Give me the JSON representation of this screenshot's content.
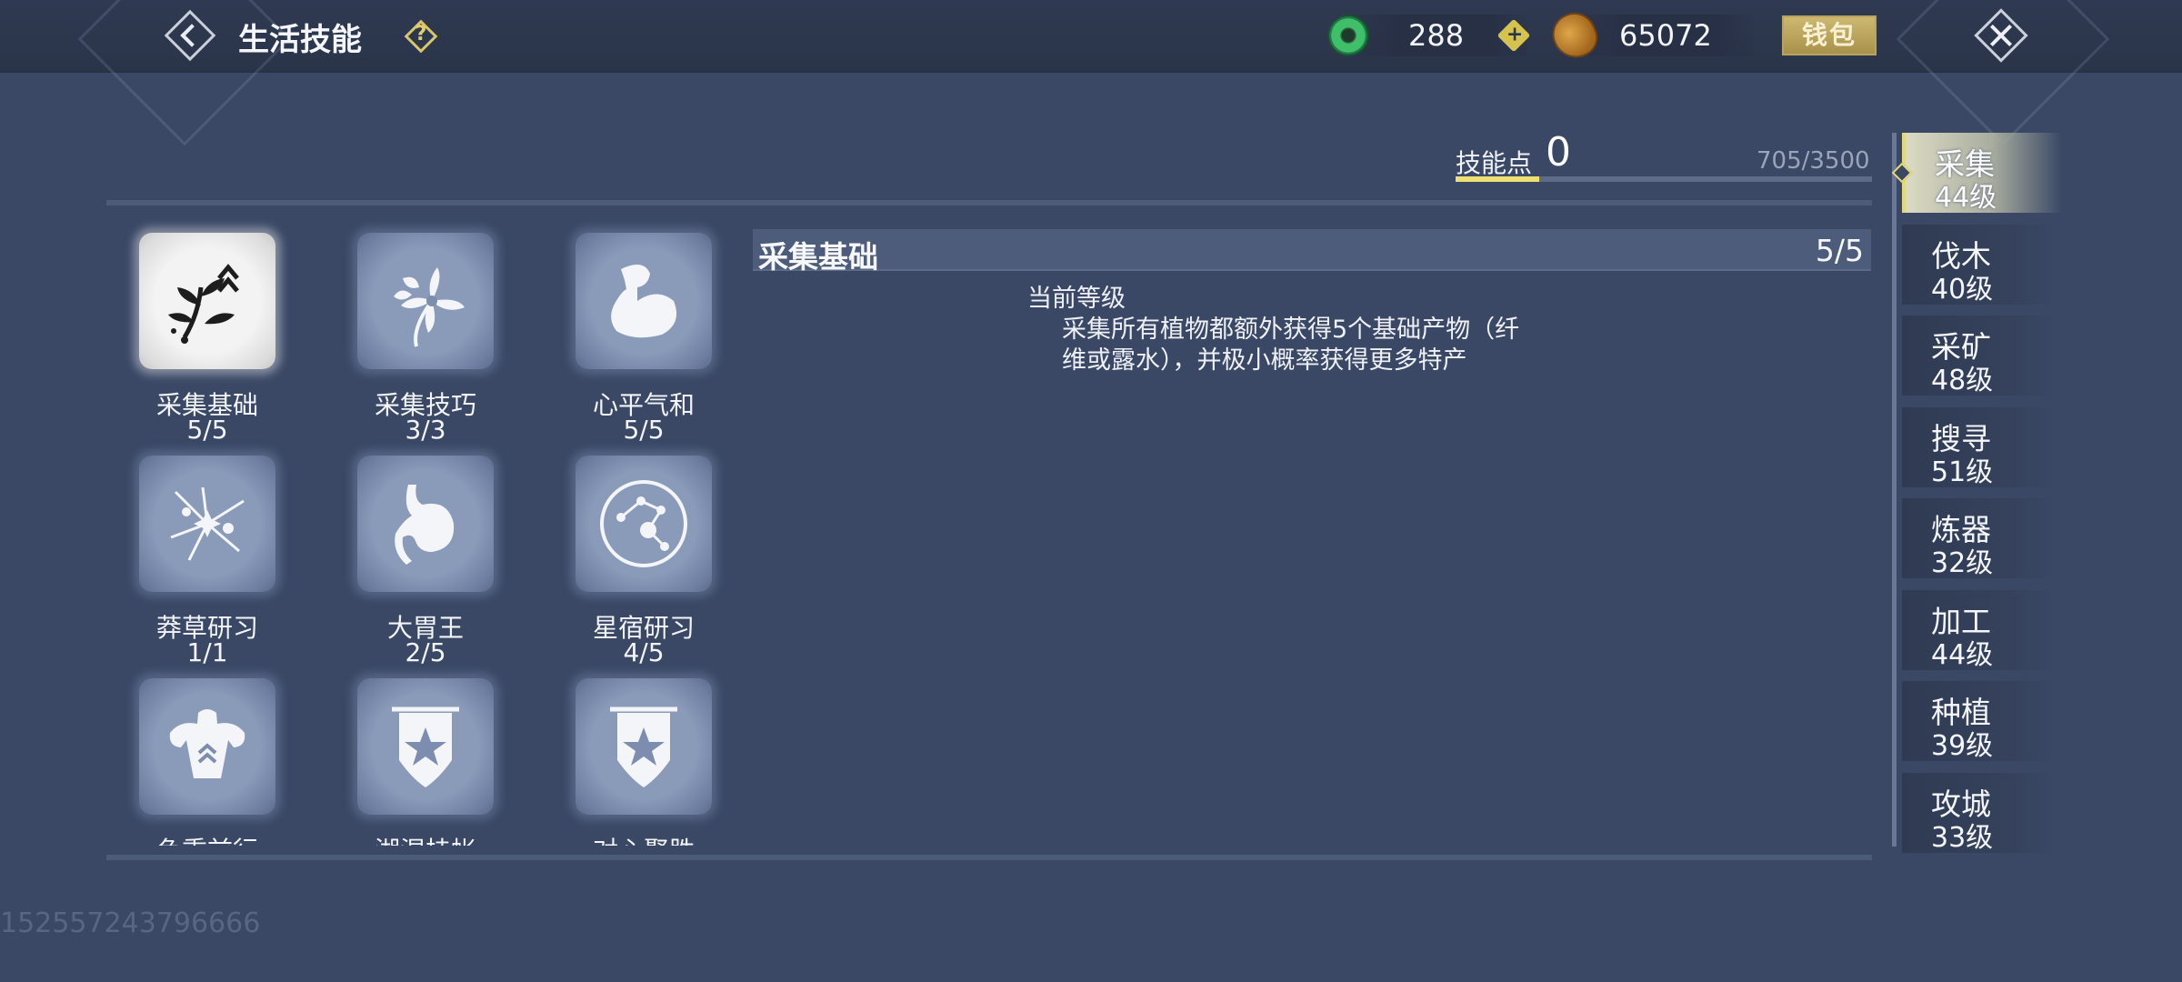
{
  "header": {
    "title": "生活技能",
    "help_glyph": "?",
    "jade_value": "288",
    "plus_glyph": "+",
    "coin_value": "65072",
    "wallet_label": "钱包"
  },
  "skill_points": {
    "label": "技能点",
    "value": "0",
    "progress_text": "705/3500",
    "progress_fraction": 0.2014
  },
  "skills": [
    {
      "name": "采集基础",
      "level": "5/5",
      "icon": "plant-harvest-icon",
      "selected": true
    },
    {
      "name": "采集技巧",
      "level": "3/3",
      "icon": "flower-icon"
    },
    {
      "name": "心平气和",
      "level": "5/5",
      "icon": "flexed-arm-icon"
    },
    {
      "name": "莽草研习",
      "level": "1/1",
      "icon": "herb-bundle-icon"
    },
    {
      "name": "大胃王",
      "level": "2/5",
      "icon": "stomach-icon"
    },
    {
      "name": "星宿研习",
      "level": "4/5",
      "icon": "constellation-icon"
    },
    {
      "name": "负重前行",
      "level": "",
      "icon": "muscular-torso-icon"
    },
    {
      "name": "湖湿挂帐",
      "level": "",
      "icon": "star-banner-icon"
    },
    {
      "name": "对心聚胜",
      "level": "",
      "icon": "star-banner-icon"
    }
  ],
  "detail": {
    "title": "采集基础",
    "level": "5/5",
    "current_level_label": "当前等级",
    "current_level_desc": "采集所有植物都额外获得5个基础产物（纤维或露水），并极小概率获得更多特产"
  },
  "categories": [
    {
      "name": "采集",
      "level": "44级",
      "active": true
    },
    {
      "name": "伐木",
      "level": "40级"
    },
    {
      "name": "采矿",
      "level": "48级"
    },
    {
      "name": "搜寻",
      "level": "51级"
    },
    {
      "name": "炼器",
      "level": "32级"
    },
    {
      "name": "加工",
      "level": "44级"
    },
    {
      "name": "种植",
      "level": "39级"
    },
    {
      "name": "攻城",
      "level": "33级"
    }
  ],
  "uid": "152557243796666",
  "colors": {
    "accent": "#ece073",
    "background": "#3a4866",
    "selected_tile": "#f3f3f3"
  }
}
